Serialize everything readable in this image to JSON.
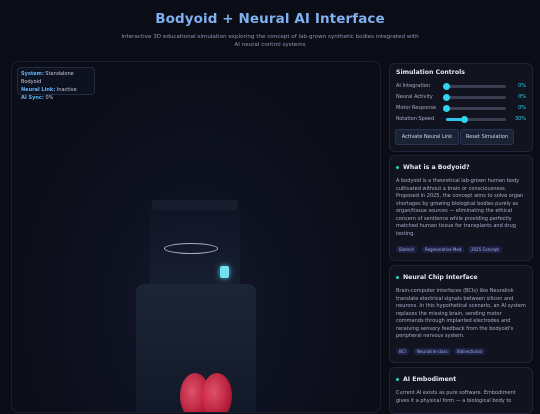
{
  "header": {
    "title": "Bodyoid + Neural AI Interface",
    "subtitle": "Interactive 3D educational simulation exploring the concept of lab-grown synthetic bodies integrated with AI neural control systems"
  },
  "status": {
    "system_label": "System:",
    "system_value": "Standalone Bodyoid",
    "link_label": "Neural Link:",
    "link_value": "Inactive",
    "sync_label": "AI Sync:",
    "sync_value": "0%"
  },
  "controls": {
    "title": "Simulation Controls",
    "sliders": [
      {
        "label": "AI Integration",
        "value": "0%",
        "level": 0
      },
      {
        "label": "Neural Activity",
        "value": "0%",
        "level": 0
      },
      {
        "label": "Motor Response",
        "value": "0%",
        "level": 0
      },
      {
        "label": "Rotation Speed",
        "value": "30%",
        "level": 0.3
      }
    ],
    "activate_button": "Activate Neural Link",
    "reset_button": "Reset Simulation"
  },
  "cards": [
    {
      "title": "What is a Bodyoid?",
      "body": "A bodyoid is a theoretical lab-grown human body cultivated without a brain or consciousness. Proposed in 2025, the concept aims to solve organ shortages by growing biological bodies purely as organ/tissue sources — eliminating the ethical concern of sentience while providing perfectly matched human tissue for transplants and drug testing.",
      "tags": [
        "Biotech",
        "Regenerative Med",
        "2025 Concept"
      ]
    },
    {
      "title": "Neural Chip Interface",
      "body": "Brain-computer interfaces (BCIs) like Neuralink translate electrical signals between silicon and neurons. In this hypothetical scenario, an AI system replaces the missing brain, sending motor commands through implanted electrodes and receiving sensory feedback from the bodyoid's peripheral nervous system.",
      "tags": [
        "BCI",
        "Neuralink-class",
        "Bidirectional"
      ]
    },
    {
      "title": "AI Embodiment",
      "body": "Current AI exists as pure software. Embodiment gives it a physical form — a biological body to"
    }
  ],
  "colors": {
    "accent": "#2ec5e8",
    "title": "#7fb0ef",
    "organ": "#d12a47",
    "card_dot": "#2cd4b8"
  }
}
